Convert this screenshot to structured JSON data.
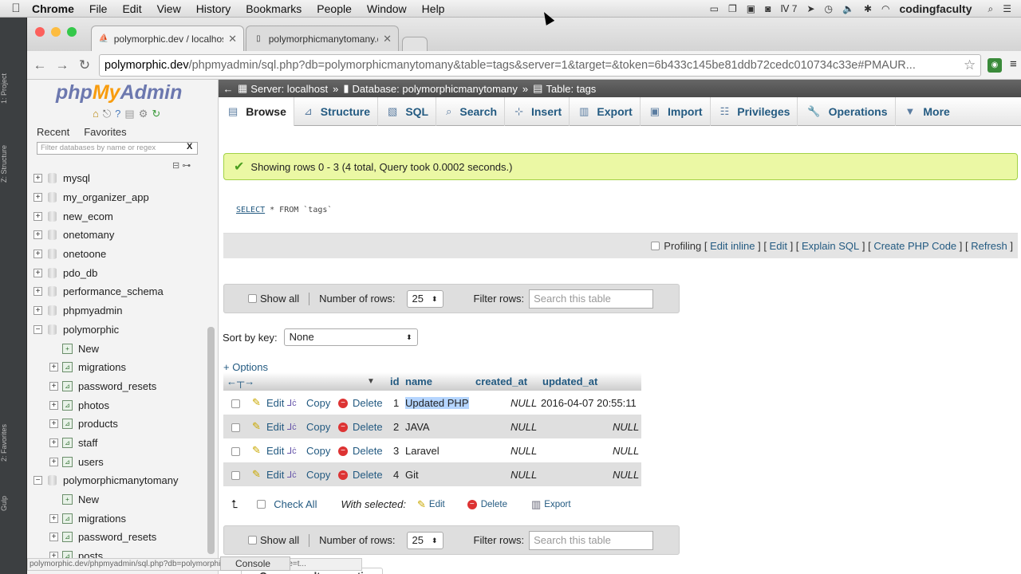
{
  "macmenu": {
    "app": "Chrome",
    "items": [
      "File",
      "Edit",
      "View",
      "History",
      "Bookmarks",
      "People",
      "Window",
      "Help"
    ],
    "tray_num": "7",
    "user": "codingfaculty"
  },
  "tabs": [
    {
      "title": "polymorphic.dev / localhost",
      "active": true
    },
    {
      "title": "polymorphicmanytomany.dev",
      "active": false
    }
  ],
  "address": {
    "host": "polymorphic.dev",
    "path": "/phpmyadmin/sql.php?db=polymorphicmanytomany&table=tags&server=1&target=&token=6b433c145be81ddb72cedc010734c33e#PMAUR..."
  },
  "sidebar": {
    "logo_php": "php",
    "logo_my": "My",
    "logo_admin": "Admin",
    "recent": "Recent",
    "favorites": "Favorites",
    "filter_placeholder": "Filter databases by name or regex",
    "filter_clear": "X",
    "tree": [
      {
        "label": "mysql",
        "level": 0,
        "type": "db"
      },
      {
        "label": "my_organizer_app",
        "level": 0,
        "type": "db"
      },
      {
        "label": "new_ecom",
        "level": 0,
        "type": "db"
      },
      {
        "label": "onetomany",
        "level": 0,
        "type": "db"
      },
      {
        "label": "onetoone",
        "level": 0,
        "type": "db"
      },
      {
        "label": "pdo_db",
        "level": 0,
        "type": "db"
      },
      {
        "label": "performance_schema",
        "level": 0,
        "type": "db"
      },
      {
        "label": "phpmyadmin",
        "level": 0,
        "type": "db"
      },
      {
        "label": "polymorphic",
        "level": 0,
        "type": "db-open"
      },
      {
        "label": "New",
        "level": 1,
        "type": "new"
      },
      {
        "label": "migrations",
        "level": 1,
        "type": "table"
      },
      {
        "label": "password_resets",
        "level": 1,
        "type": "table"
      },
      {
        "label": "photos",
        "level": 1,
        "type": "table"
      },
      {
        "label": "products",
        "level": 1,
        "type": "table"
      },
      {
        "label": "staff",
        "level": 1,
        "type": "table"
      },
      {
        "label": "users",
        "level": 1,
        "type": "table"
      },
      {
        "label": "polymorphicmanytomany",
        "level": 0,
        "type": "db-open"
      },
      {
        "label": "New",
        "level": 1,
        "type": "new"
      },
      {
        "label": "migrations",
        "level": 1,
        "type": "table"
      },
      {
        "label": "password_resets",
        "level": 1,
        "type": "table"
      },
      {
        "label": "posts",
        "level": 1,
        "type": "table"
      }
    ]
  },
  "breadcrumb": {
    "server": "Server: localhost",
    "database": "Database: polymorphicmanytomany",
    "table": "Table: tags"
  },
  "menu_tabs": [
    "Browse",
    "Structure",
    "SQL",
    "Search",
    "Insert",
    "Export",
    "Import",
    "Privileges",
    "Operations",
    "More"
  ],
  "success_message": "Showing rows 0 - 3 (4 total, Query took 0.0002 seconds.)",
  "sql": {
    "select": "SELECT",
    "rest": " * FROM `tags`"
  },
  "sql_links": {
    "profiling": "Profiling",
    "links": [
      "Edit inline",
      "Edit",
      "Explain SQL",
      "Create PHP Code",
      "Refresh"
    ]
  },
  "nav_controls": {
    "show_all": "Show all",
    "number_of_rows": "Number of rows:",
    "rows_value": "25",
    "filter_rows": "Filter rows:",
    "filter_placeholder": "Search this table"
  },
  "sort": {
    "label": "Sort by key:",
    "value": "None"
  },
  "options_link": "+ Options",
  "columns": [
    "id",
    "name",
    "created_at",
    "updated_at"
  ],
  "actions": {
    "edit": "Edit",
    "copy": "Copy",
    "delete": "Delete"
  },
  "rows": [
    {
      "id": "1",
      "name": "Updated PHP",
      "created_at": "NULL",
      "updated_at": "2016-04-07 20:55:11"
    },
    {
      "id": "2",
      "name": "JAVA",
      "created_at": "NULL",
      "updated_at": "NULL"
    },
    {
      "id": "3",
      "name": "Laravel",
      "created_at": "NULL",
      "updated_at": "NULL"
    },
    {
      "id": "4",
      "name": "Git",
      "created_at": "NULL",
      "updated_at": "NULL"
    }
  ],
  "with_selected": {
    "check_all": "Check All",
    "label": "With selected:",
    "edit": "Edit",
    "delete": "Delete",
    "export": "Export"
  },
  "query_results_operations": "Query results operations",
  "status_bar": "polymorphic.dev/phpmyadmin/sql.php?db=polymorphicmanytomany&table=t...",
  "console_label": "Console"
}
